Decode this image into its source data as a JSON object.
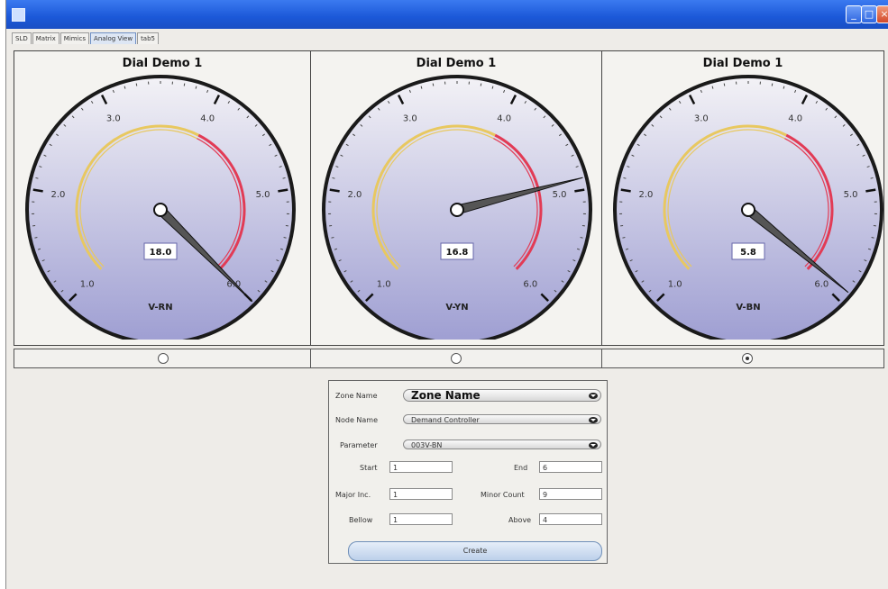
{
  "window": {
    "title": ""
  },
  "tabs": [
    {
      "label": "SLD",
      "active": false
    },
    {
      "label": "Matrix",
      "active": false
    },
    {
      "label": "Mimics",
      "active": false
    },
    {
      "label": "Analog View",
      "active": true
    },
    {
      "label": "tab5",
      "active": false
    }
  ],
  "dial_scale": {
    "min": 1.0,
    "max": 6.0,
    "tick_labels": [
      "1.0",
      "2.0",
      "3.0",
      "4.0",
      "5.0",
      "6.0"
    ],
    "yellow_range": [
      1.0,
      4.0
    ],
    "red_range": [
      4.0,
      6.0
    ],
    "colors": {
      "face_top": "#f3f2f6",
      "face_bottom": "#9e9ed2",
      "yellow": "#e8c860",
      "red": "#e23b55",
      "needle": "#555555",
      "rim": "#1a1a1a"
    }
  },
  "dials": [
    {
      "title": "Dial Demo 1",
      "unit_label": "V-RN",
      "readout": "18.0",
      "needle_value": 6.0,
      "selected": false
    },
    {
      "title": "Dial Demo 1",
      "unit_label": "V-YN",
      "readout": "16.8",
      "needle_value": 4.9,
      "selected": false
    },
    {
      "title": "Dial Demo 1",
      "unit_label": "V-BN",
      "readout": "5.8",
      "needle_value": 5.9,
      "selected": true
    }
  ],
  "form": {
    "zone_label": "Zone Name",
    "zone_value": "Zone Name",
    "node_label": "Node Name",
    "node_value": "Demand Controller",
    "param_label": "Parameter",
    "param_value": "003V-BN",
    "start_label": "Start",
    "start_value": "1",
    "end_label": "End",
    "end_value": "6",
    "major_label": "Major Inc.",
    "major_value": "1",
    "minor_label": "Minor Count",
    "minor_value": "9",
    "below_label": "Bellow",
    "below_value": "1",
    "above_label": "Above",
    "above_value": "4",
    "create_label": "Create"
  }
}
